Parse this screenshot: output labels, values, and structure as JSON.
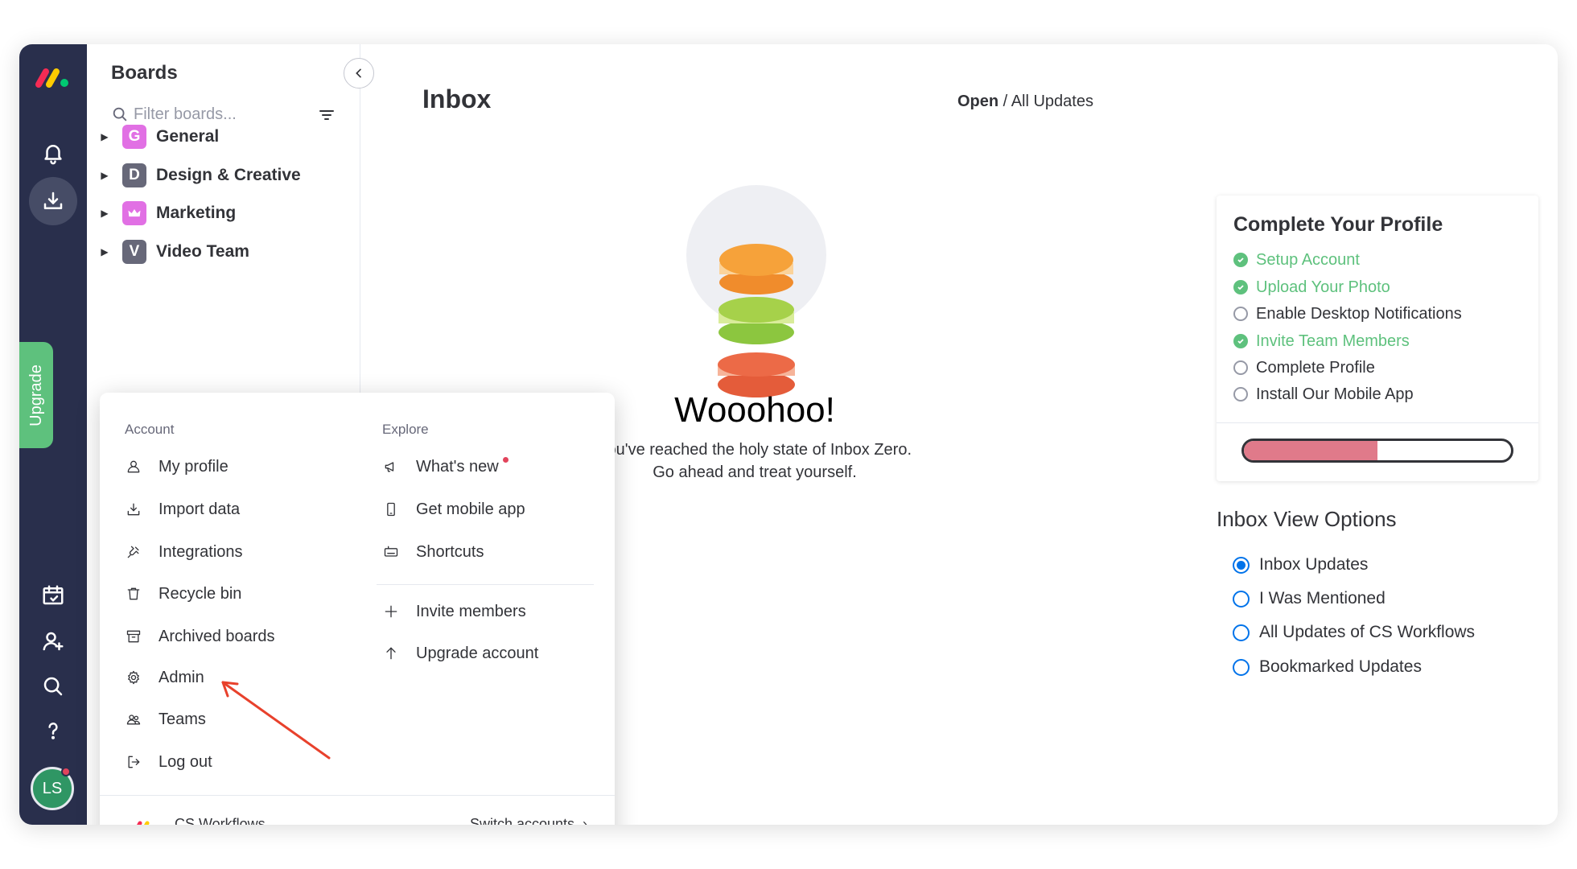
{
  "rail": {
    "upgrade_label": "Upgrade",
    "avatar_initials": "LS",
    "icons": [
      "notifications-bell-icon",
      "inbox-download-icon",
      "my-work-calendar-icon",
      "invite-person-icon",
      "search-icon",
      "help-question-icon"
    ]
  },
  "boards": {
    "title": "Boards",
    "filter_placeholder": "Filter boards...",
    "items": [
      {
        "letter": "G",
        "label": "General",
        "color": "#e170e4"
      },
      {
        "letter": "D",
        "label": "Design & Creative",
        "color": "#676879"
      },
      {
        "letter": "",
        "label": "Marketing",
        "color": "#e170e4",
        "icon": "crown-icon"
      },
      {
        "letter": "V",
        "label": "Video Team",
        "color": "#676879"
      }
    ]
  },
  "main": {
    "title": "Inbox",
    "crumb_strong": "Open",
    "crumb_sep": " / ",
    "crumb_rest": "All Updates",
    "empty_title": "Wooohoo!",
    "empty_line1": "You've reached the holy state of Inbox Zero.",
    "empty_line2": "Go ahead and treat yourself."
  },
  "profile": {
    "title": "Complete Your Profile",
    "steps": [
      {
        "label": "Setup Account",
        "done": true
      },
      {
        "label": "Upload Your Photo",
        "done": true
      },
      {
        "label": "Enable Desktop Notifications",
        "done": false
      },
      {
        "label": "Invite Team Members",
        "done": true
      },
      {
        "label": "Complete Profile",
        "done": false
      },
      {
        "label": "Install Our Mobile App",
        "done": false
      }
    ],
    "progress_fraction": 0.5,
    "progress_color": "#e07a8a"
  },
  "view_options": {
    "title": "Inbox View Options",
    "options": [
      {
        "label": "Inbox Updates",
        "selected": true
      },
      {
        "label": "I Was Mentioned",
        "selected": false
      },
      {
        "label": "All Updates of CS Workflows",
        "selected": false
      },
      {
        "label": "Bookmarked Updates",
        "selected": false
      }
    ]
  },
  "menu": {
    "account_heading": "Account",
    "explore_heading": "Explore",
    "account_items": [
      {
        "label": "My profile",
        "icon": "person-icon"
      },
      {
        "label": "Import data",
        "icon": "import-download-icon"
      },
      {
        "label": "Integrations",
        "icon": "integrations-plug-icon"
      },
      {
        "label": "Recycle bin",
        "icon": "trash-icon"
      },
      {
        "label": "Archived boards",
        "icon": "archive-box-icon"
      },
      {
        "label": "Admin",
        "icon": "gear-icon"
      },
      {
        "label": "Teams",
        "icon": "team-people-icon"
      },
      {
        "label": "Log out",
        "icon": "logout-icon"
      }
    ],
    "explore_items": [
      {
        "label": "What's new",
        "icon": "megaphone-icon"
      },
      {
        "label": "Get mobile app",
        "icon": "mobile-phone-icon"
      },
      {
        "label": "Shortcuts",
        "icon": "keyboard-icon"
      },
      {
        "label": "Invite members",
        "icon": "plus-icon"
      },
      {
        "label": "Upgrade account",
        "icon": "arrow-up-icon"
      }
    ],
    "workspace_name": "CS Workflows",
    "switch_label": "Switch accounts"
  },
  "colors": {
    "rail_bg": "#292f4c",
    "success_green": "#5ec17d",
    "primary_blue": "#0073ea",
    "annotation_arrow": "#e8412c"
  }
}
